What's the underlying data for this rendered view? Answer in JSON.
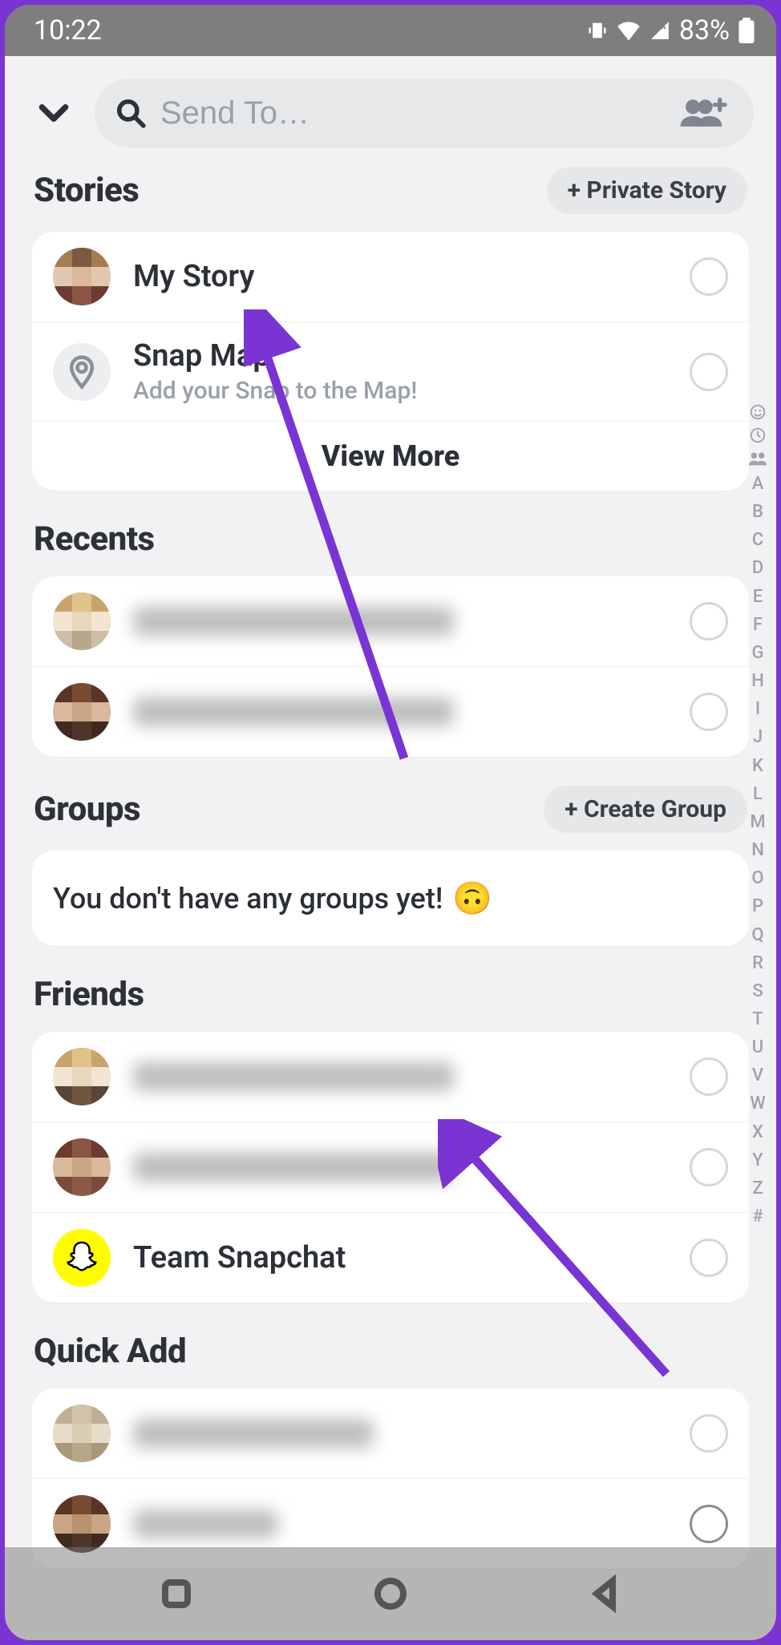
{
  "status": {
    "time": "10:22",
    "battery_pct": "83%"
  },
  "header": {
    "search_placeholder": "Send To…"
  },
  "sections": {
    "stories": {
      "title": "Stories",
      "button": "+ Private Story",
      "items": [
        {
          "title": "My Story",
          "sub": ""
        },
        {
          "title": "Snap Map",
          "sub": "Add your Snap to the Map!"
        }
      ],
      "view_more": "View More"
    },
    "recents": {
      "title": "Recents",
      "items": [
        {
          "title_hidden": true
        },
        {
          "title_hidden": true
        }
      ]
    },
    "groups": {
      "title": "Groups",
      "button": "+ Create Group",
      "empty_msg": "You don't have any groups yet!"
    },
    "friends": {
      "title": "Friends",
      "items": [
        {
          "title_hidden": true
        },
        {
          "title_hidden": true
        },
        {
          "title": "Team Snapchat"
        }
      ]
    },
    "quickadd": {
      "title": "Quick Add",
      "items": [
        {
          "title_hidden": true
        },
        {
          "title_hidden": true
        }
      ]
    }
  },
  "index_rail": [
    "A",
    "B",
    "C",
    "D",
    "E",
    "F",
    "G",
    "H",
    "I",
    "J",
    "K",
    "L",
    "M",
    "N",
    "O",
    "P",
    "Q",
    "R",
    "S",
    "T",
    "U",
    "V",
    "W",
    "X",
    "Y",
    "Z",
    "#"
  ],
  "colors": {
    "accent_arrow": "#7a34d4"
  }
}
